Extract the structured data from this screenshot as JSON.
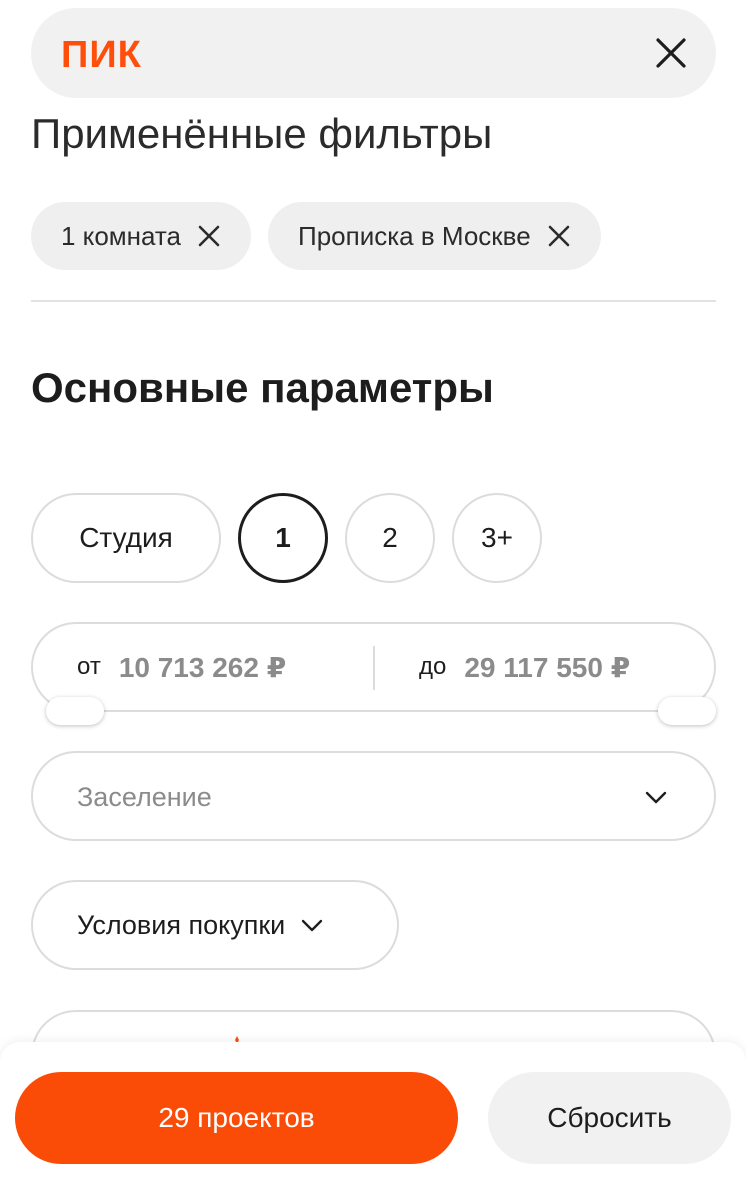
{
  "header": {
    "logo_text": "ПИК",
    "close_icon": "close-icon",
    "brand_color": "#ff4e0c"
  },
  "applied_filters": {
    "title": "Применённые фильтры",
    "chips": [
      {
        "label": "1 комната",
        "icon": "close-icon"
      },
      {
        "label": "Прописка в Москве",
        "icon": "close-icon"
      }
    ]
  },
  "main_params": {
    "title": "Основные параметры",
    "rooms": [
      {
        "label": "Студия",
        "selected": false
      },
      {
        "label": "1",
        "selected": true
      },
      {
        "label": "2",
        "selected": false
      },
      {
        "label": "3+",
        "selected": false
      }
    ],
    "price": {
      "from_label": "от",
      "from_value": "10 713 262 ₽",
      "to_label": "до",
      "to_value": "29 117 550 ₽"
    },
    "settlement": {
      "placeholder": "Заселение",
      "icon": "chevron-down-icon"
    },
    "purchase_conditions": {
      "label": "Условия покупки",
      "icon": "chevron-down-icon"
    }
  },
  "footer": {
    "primary_label": "29 проектов",
    "reset_label": "Сбросить",
    "accent_color": "#fb4c07"
  }
}
